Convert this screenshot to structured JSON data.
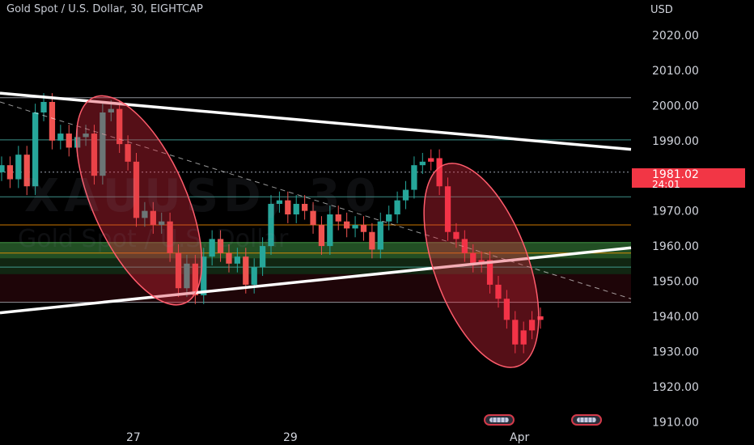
{
  "header": {
    "title": "Gold Spot / U.S. Dollar, 30, EIGHTCAP"
  },
  "watermark": {
    "symbol": "XAUUSD, 30",
    "name": "Gold Spot / U.S. Dollar"
  },
  "last_price": {
    "value": "1981.02",
    "countdown": "24:01",
    "color": "#f23645"
  },
  "colors": {
    "up": "#26a69a",
    "down": "#ef5350",
    "trendline": "#ffffff",
    "ellipse": "#e0283c"
  },
  "icons": [
    "us-flag-event-icon",
    "us-flag-event-icon"
  ],
  "chart_data": {
    "type": "candlestick",
    "title": "Gold Spot / U.S. Dollar, 30, EIGHTCAP",
    "unit": "USD",
    "ylim": [
      1908,
      2030
    ],
    "y_ticks": [
      "2020.00",
      "2010.00",
      "2000.00",
      "1990.00",
      "1980.00",
      "1970.00",
      "1960.00",
      "1950.00",
      "1940.00",
      "1930.00",
      "1920.00",
      "1910.00"
    ],
    "x_ticks": [
      "27",
      "29",
      "Apr"
    ],
    "horizontal_levels": [
      2002.2,
      1990.2,
      1974.0,
      1966.0,
      1961.0,
      1958.0,
      1954.0,
      1944.0
    ],
    "zones": [
      {
        "from": 1956.5,
        "to": 1961.0,
        "color": "green"
      },
      {
        "from": 1952.0,
        "to": 1956.5,
        "color": "green-light"
      }
    ],
    "trendlines": [
      {
        "from": 2003.5,
        "to": 1987.5,
        "style": "solid",
        "note": "upper"
      },
      {
        "from": 1941.0,
        "to": 1959.5,
        "style": "solid",
        "note": "lower"
      },
      {
        "from": 2001.0,
        "to": 1945.0,
        "style": "dashed"
      }
    ],
    "series": [
      {
        "values": [
          1983,
          1979,
          1986,
          1977,
          1998,
          2001,
          1990,
          1992,
          1988,
          1991,
          1992,
          1980,
          1998,
          1999,
          1989,
          1984,
          1968,
          1970,
          1966,
          1967,
          1958,
          1948,
          1955,
          1946,
          1957,
          1962,
          1958,
          1955,
          1957,
          1949,
          1954,
          1960,
          1972,
          1973,
          1969,
          1972,
          1970,
          1966,
          1960,
          1969,
          1967,
          1965,
          1966,
          1964,
          1959,
          1967,
          1969,
          1973,
          1976,
          1983,
          1984,
          1985,
          1977,
          1964,
          1962,
          1958,
          1955,
          1956,
          1949,
          1945,
          1939,
          1932,
          1936,
          1939,
          1940
        ]
      }
    ]
  }
}
